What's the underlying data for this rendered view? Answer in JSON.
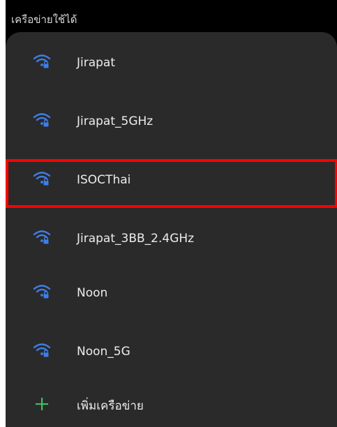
{
  "section": {
    "header": "เครือข่ายใช้ได้"
  },
  "networks": [
    {
      "ssid": "Jirapat",
      "icon": "wifi-lock-icon"
    },
    {
      "ssid": "Jirapat_5GHz",
      "icon": "wifi-lock-icon"
    },
    {
      "ssid": "ISOCThai",
      "icon": "wifi-lock-icon"
    },
    {
      "ssid": "Jirapat_3BB_2.4GHz",
      "icon": "wifi-lock-icon"
    },
    {
      "ssid": "Noon",
      "icon": "wifi-lock-icon"
    },
    {
      "ssid": "Noon_5G",
      "icon": "wifi-lock-icon"
    }
  ],
  "add_network": {
    "label": "เพิ่มเครือข่าย",
    "icon": "plus-icon"
  },
  "highlight": {
    "target": "ISOCThai",
    "color": "#ff0000"
  },
  "colors": {
    "wifi_icon": "#3f7ee8",
    "plus_icon": "#3fbf5f",
    "card_background": "#2a2a2a",
    "screen_background": "#000000"
  }
}
